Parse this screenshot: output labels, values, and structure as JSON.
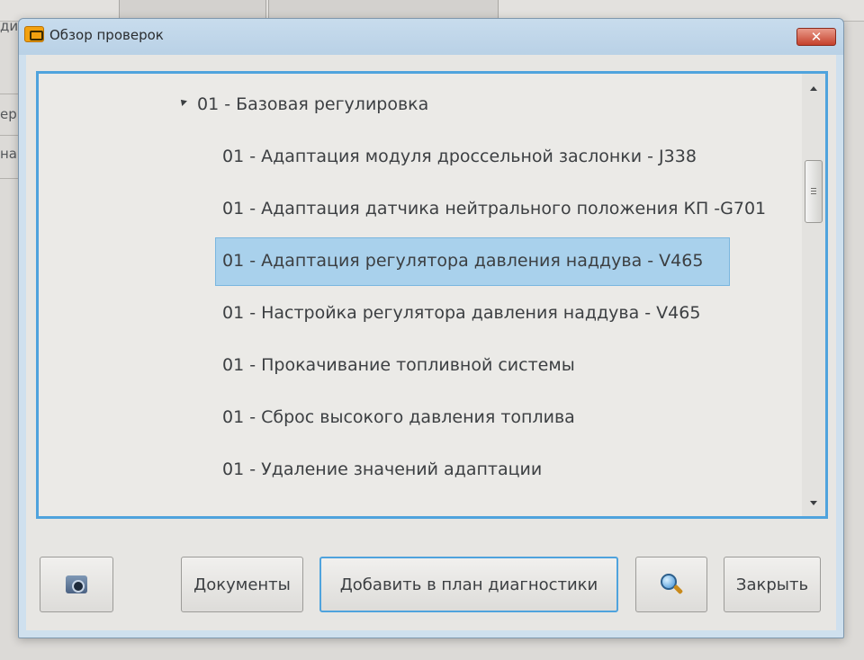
{
  "background": {
    "side_texts": [
      "ди",
      "ер",
      "на"
    ]
  },
  "dialog": {
    "title": "Обзор проверок",
    "close_glyph": "✕",
    "app_icon": "engine-check-icon"
  },
  "tree": {
    "group_label": "01 - Базовая регулировка",
    "items": [
      {
        "label": "01 - Адаптация модуля дроссельной заслонки - J338",
        "selected": false
      },
      {
        "label": "01 - Адаптация датчика нейтрального положения КП -G701",
        "selected": false
      },
      {
        "label": "01 - Адаптация регулятора давления наддува - V465",
        "selected": true
      },
      {
        "label": "01 - Настройка регулятора давления наддува - V465",
        "selected": false
      },
      {
        "label": "01 - Прокачивание топливной системы",
        "selected": false
      },
      {
        "label": "01 - Сброс высокого давления топлива",
        "selected": false
      },
      {
        "label": "01 - Удаление значений адаптации",
        "selected": false
      }
    ]
  },
  "buttons": {
    "camera_icon": "camera-icon",
    "documents": "Документы",
    "add_to_plan": "Добавить в план диагностики",
    "search_icon": "search-icon",
    "close": "Закрыть"
  },
  "colors": {
    "accent": "#4fa3dd",
    "selection": "#a9d1ec",
    "close_red": "#c5412c"
  }
}
